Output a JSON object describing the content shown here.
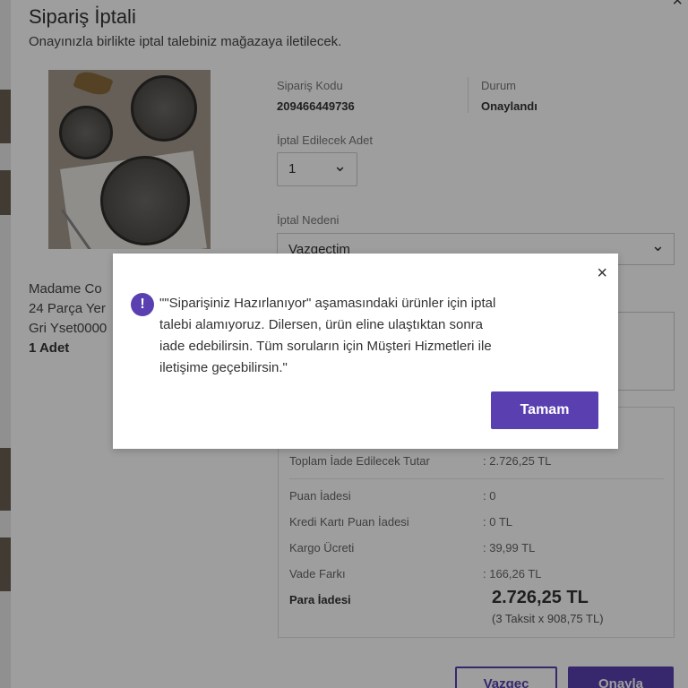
{
  "modal": {
    "title": "Sipariş İptali",
    "subtitle": "Onayınızla birlikte iptal talebiniz mağazaya iletilecek.",
    "close_label": "×"
  },
  "product": {
    "name": "Madame Co\n24 Parça Yer\nGri Yset0000",
    "quantity": "1 Adet"
  },
  "order": {
    "code_label": "Sipariş Kodu",
    "code_value": "209466449736",
    "status_label": "Durum",
    "status_value": "Onaylandı"
  },
  "cancel_qty": {
    "label": "İptal Edilecek Adet",
    "value": "1"
  },
  "cancel_reason": {
    "label": "İptal Nedeni",
    "value": "Vazgeçtim"
  },
  "summary": {
    "total_refund_label": "Toplam İade Edilecek Tutar",
    "total_refund_value": ": 2.726,25 TL",
    "rows": [
      {
        "label": "Puan İadesi",
        "value": ": 0"
      },
      {
        "label": "Kredi Kartı Puan İadesi",
        "value": ": 0 TL"
      },
      {
        "label": "Kargo Ücreti",
        "value": ": 39,99 TL"
      },
      {
        "label": "Vade Farkı",
        "value": ": 166,26 TL"
      }
    ],
    "refund_label": "Para İadesi",
    "refund_value": "2.726,25 TL",
    "refund_installments": "(3 Taksit x 908,75 TL)"
  },
  "buttons": {
    "cancel": "Vazgeç",
    "confirm": "Onayla"
  },
  "alert": {
    "icon": "!",
    "close_label": "×",
    "message": "\"\"Siparişiniz Hazırlanıyor\" aşamasındaki ürünler için iptal\ntalebi alamıyoruz. Dilersen, ürün eline ulaştıktan sonra\niade edebilirsin. Tüm soruların için Müşteri Hizmetleri ile\niletişime geçebilirsin.\"",
    "ok_label": "Tamam"
  },
  "colors": {
    "accent": "#5a3fb0"
  }
}
